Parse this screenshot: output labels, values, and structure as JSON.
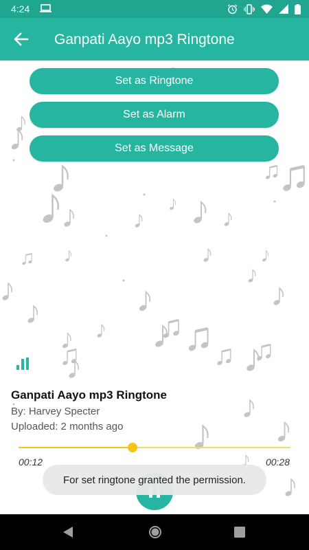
{
  "status_bar": {
    "time": "4:24",
    "icons": [
      "laptop-icon",
      "alarm-icon",
      "vibrate-icon",
      "wifi-icon",
      "signal-icon",
      "battery-icon"
    ]
  },
  "app_bar": {
    "title": "Ganpati Aayo mp3 Ringtone",
    "back_icon": "arrow-left-icon"
  },
  "actions": {
    "set_ringtone": "Set as Ringtone",
    "set_alarm": "Set as Alarm",
    "set_message": "Set as Message"
  },
  "song": {
    "title": "Ganpati Aayo mp3 Ringtone",
    "author": "By: Harvey Specter",
    "uploaded": "Uploaded: 2 months ago"
  },
  "player": {
    "current_time": "00:12",
    "total_time": "00:28",
    "progress_percent": 42,
    "state": "playing",
    "button_icon": "pause-icon"
  },
  "toast": {
    "message": "For set ringtone granted the permission."
  },
  "nav": {
    "back_icon": "triangle-back-icon",
    "home_icon": "circle-home-icon",
    "recents_icon": "square-recents-icon"
  },
  "colors": {
    "primary": "#26b5a0",
    "status_bar": "#1fa590",
    "accent": "#f5c518"
  }
}
